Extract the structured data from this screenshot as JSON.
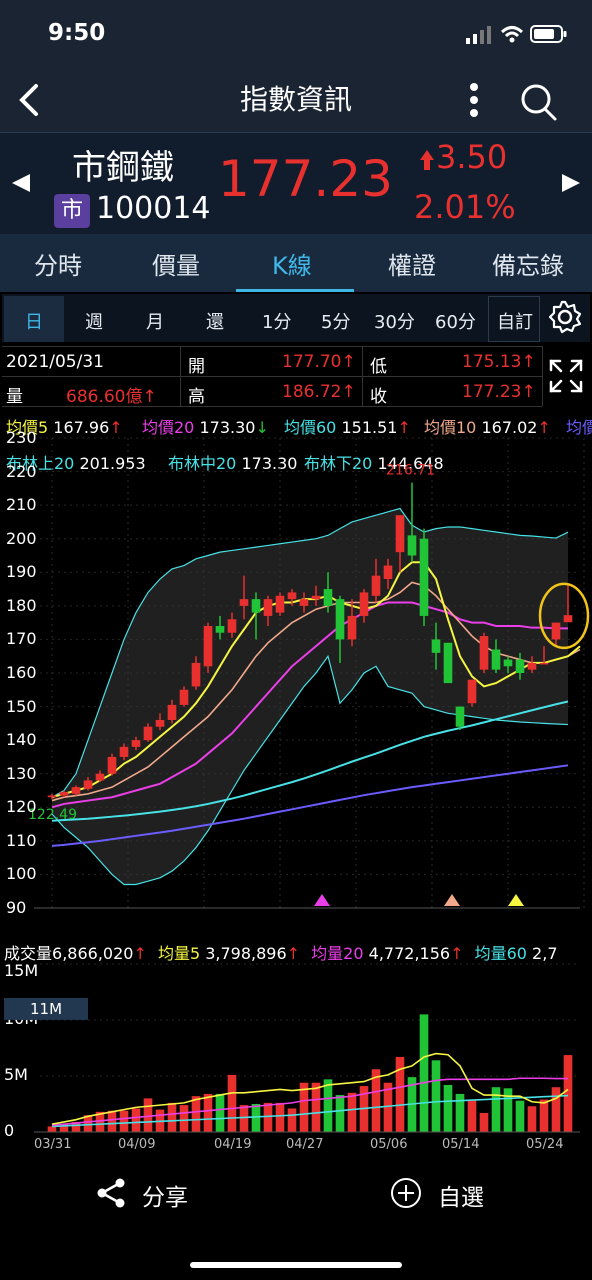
{
  "status": {
    "time": "9:50"
  },
  "nav": {
    "title": "指數資訊"
  },
  "quote": {
    "name": "市鋼鐵",
    "badge": "市",
    "code": "100014",
    "price": "177.23",
    "change": "3.50",
    "percent": "2.01%"
  },
  "tabs": [
    "分時",
    "價量",
    "K線",
    "權證",
    "備忘錄"
  ],
  "periods": [
    "日",
    "週",
    "月",
    "還",
    "1分",
    "5分",
    "30分",
    "60分",
    "自訂"
  ],
  "info": {
    "date": "2021/05/31",
    "open_label": "開",
    "open": "177.70↑",
    "low_label": "低",
    "low": "175.13↑",
    "vol_label": "量",
    "vol": "686.60億↑",
    "high_label": "高",
    "high": "186.72↑",
    "close_label": "收",
    "close": "177.23↑"
  },
  "ma_legend": [
    {
      "label": "均價5",
      "value": "167.96",
      "arrow": "↑",
      "color": "#f5f542"
    },
    {
      "label": "均價20",
      "value": "173.30",
      "arrow": "↓",
      "color": "#ea3fe8"
    },
    {
      "label": "均價60",
      "value": "151.51",
      "arrow": "↑",
      "color": "#47e1e6"
    },
    {
      "label": "均價10",
      "value": "167.02",
      "arrow": "↑",
      "color": "#f2a98b"
    },
    {
      "label": "均價",
      "value": "",
      "arrow": "",
      "color": "#6a5cff"
    }
  ],
  "boll_legend": {
    "upper_label": "布林上20",
    "upper": "201.953",
    "mid_label": "布林中20",
    "mid": "173.30",
    "lower_label": "布林下20",
    "lower": "144.648"
  },
  "price_axis": [
    "230",
    "220",
    "210",
    "200",
    "190",
    "180",
    "170",
    "160",
    "150",
    "140",
    "130",
    "120",
    "110",
    "100",
    "90"
  ],
  "max_label": "216.71",
  "min_label": "122.49",
  "vol_legend": {
    "label": "成交量",
    "value": "6,866,020",
    "ma5_label": "均量5",
    "ma5": "3,798,896",
    "ma20_label": "均量20",
    "ma20": "4,772,156",
    "ma60_label": "均量60",
    "ma60": "2,7"
  },
  "vol_axis": [
    "15M",
    "10M",
    "5M",
    "0"
  ],
  "vol_tag": "11M",
  "dates": [
    "03/31",
    "04/09",
    "04/19",
    "04/27",
    "05/06",
    "05/14",
    "05/24"
  ],
  "bottom": {
    "share": "分享",
    "watch": "自選"
  },
  "colors": {
    "up": "#e8312f",
    "down": "#22c437",
    "accent": "#3fb7e8"
  },
  "icons": [
    "back-arrow-icon",
    "more-vert-icon",
    "search-icon",
    "left-triangle-icon",
    "right-triangle-icon",
    "gear-icon",
    "expand-icon",
    "share-icon",
    "add-circle-icon"
  ],
  "chart_data": {
    "type": "candlestick",
    "ylim": [
      90,
      230
    ],
    "vol_ylim": [
      0,
      15000000
    ],
    "candles": [
      {
        "o": 123,
        "h": 124,
        "l": 122.49,
        "c": 123.5
      },
      {
        "o": 123.5,
        "h": 125,
        "l": 123,
        "c": 124.5
      },
      {
        "o": 124,
        "h": 126.5,
        "l": 123.5,
        "c": 126
      },
      {
        "o": 125.5,
        "h": 129,
        "l": 125,
        "c": 128
      },
      {
        "o": 128,
        "h": 131,
        "l": 127.5,
        "c": 130
      },
      {
        "o": 130,
        "h": 136,
        "l": 129.5,
        "c": 135
      },
      {
        "o": 135,
        "h": 139,
        "l": 134,
        "c": 138
      },
      {
        "o": 138,
        "h": 141,
        "l": 137,
        "c": 140
      },
      {
        "o": 140,
        "h": 145,
        "l": 139.5,
        "c": 144
      },
      {
        "o": 144,
        "h": 148,
        "l": 143,
        "c": 146
      },
      {
        "o": 146,
        "h": 152,
        "l": 145,
        "c": 150.5
      },
      {
        "o": 150.5,
        "h": 156,
        "l": 150,
        "c": 155
      },
      {
        "o": 156,
        "h": 165,
        "l": 155,
        "c": 163
      },
      {
        "o": 162,
        "h": 175,
        "l": 160,
        "c": 174
      },
      {
        "o": 174,
        "h": 177,
        "l": 170,
        "c": 172
      },
      {
        "o": 172,
        "h": 178,
        "l": 170.5,
        "c": 176
      },
      {
        "o": 180,
        "h": 189,
        "l": 176,
        "c": 182
      },
      {
        "o": 182,
        "h": 184,
        "l": 170,
        "c": 178
      },
      {
        "o": 177,
        "h": 183,
        "l": 174,
        "c": 182
      },
      {
        "o": 178,
        "h": 184,
        "l": 177,
        "c": 183
      },
      {
        "o": 182,
        "h": 185,
        "l": 180,
        "c": 184
      },
      {
        "o": 180,
        "h": 184,
        "l": 178,
        "c": 182
      },
      {
        "o": 182,
        "h": 186,
        "l": 180,
        "c": 183
      },
      {
        "o": 185,
        "h": 190,
        "l": 178,
        "c": 180
      },
      {
        "o": 182,
        "h": 183,
        "l": 163,
        "c": 170
      },
      {
        "o": 170,
        "h": 182,
        "l": 168,
        "c": 177
      },
      {
        "o": 177,
        "h": 185,
        "l": 175,
        "c": 184
      },
      {
        "o": 183,
        "h": 194,
        "l": 181,
        "c": 189
      },
      {
        "o": 188,
        "h": 194,
        "l": 185,
        "c": 192
      },
      {
        "o": 196,
        "h": 207,
        "l": 190,
        "c": 207
      },
      {
        "o": 201,
        "h": 216.71,
        "l": 193,
        "c": 195
      },
      {
        "o": 200,
        "h": 203,
        "l": 174,
        "c": 177
      },
      {
        "o": 170,
        "h": 175,
        "l": 161,
        "c": 166
      },
      {
        "o": 169,
        "h": 169,
        "l": 157,
        "c": 157
      },
      {
        "o": 150,
        "h": 150,
        "l": 143,
        "c": 144
      },
      {
        "o": 151,
        "h": 158,
        "l": 150,
        "c": 158
      },
      {
        "o": 161,
        "h": 172,
        "l": 160,
        "c": 171
      },
      {
        "o": 167,
        "h": 170,
        "l": 160,
        "c": 161
      },
      {
        "o": 164,
        "h": 165,
        "l": 160,
        "c": 162
      },
      {
        "o": 164,
        "h": 166,
        "l": 158,
        "c": 160
      },
      {
        "o": 161,
        "h": 165,
        "l": 160,
        "c": 163
      },
      {
        "o": 163,
        "h": 168,
        "l": 163,
        "c": 163
      },
      {
        "o": 170,
        "h": 175,
        "l": 168,
        "c": 175
      },
      {
        "o": 175.13,
        "h": 186.72,
        "l": 175.13,
        "c": 177.23
      }
    ],
    "ma5": [
      123,
      124,
      125,
      126,
      128,
      130,
      133,
      135,
      138,
      141,
      144,
      147,
      151,
      156,
      162,
      168,
      173,
      178,
      180,
      181,
      181,
      182,
      182,
      183,
      181,
      180,
      179,
      180,
      183,
      190,
      193,
      193,
      188,
      176,
      165,
      159,
      156,
      157,
      159,
      161,
      163,
      163,
      164,
      165,
      167.96
    ],
    "ma10": [
      122,
      123,
      123.5,
      124,
      125,
      126,
      128,
      130,
      132,
      135,
      138,
      141,
      144,
      147,
      151,
      155,
      160,
      165,
      169,
      172,
      175,
      177,
      179,
      180,
      181,
      181,
      181,
      181,
      182,
      184,
      187,
      186,
      183,
      179,
      175,
      171,
      168,
      166,
      165,
      164,
      163,
      163,
      164,
      165,
      167.02
    ],
    "ma20": [
      120,
      121,
      121.5,
      122,
      122.5,
      123,
      124,
      125,
      126,
      127,
      129,
      131,
      133,
      136,
      139,
      142,
      146,
      150,
      154,
      158,
      162,
      165,
      168,
      171,
      174,
      176,
      178,
      180,
      181,
      181,
      181,
      180,
      179,
      178,
      176,
      175,
      175,
      174,
      174,
      174,
      173.5,
      173.5,
      173.3,
      173.3
    ],
    "ma60": [
      116,
      116.2,
      116.4,
      116.6,
      116.9,
      117.2,
      117.5,
      117.9,
      118.3,
      118.7,
      119.2,
      119.7,
      120.3,
      121,
      121.8,
      122.6,
      123.5,
      124.5,
      125.5,
      126.5,
      127.5,
      128.6,
      129.8,
      131,
      132.3,
      133.6,
      134.8,
      136,
      137.3,
      138.6,
      139.8,
      141,
      141.9,
      142.8,
      143.6,
      144.4,
      145.3,
      146.2,
      147.1,
      148,
      148.9,
      149.8,
      150.7,
      151.51
    ],
    "ma_long": [
      108.5,
      108.8,
      109.2,
      109.6,
      110,
      110.5,
      111,
      111.5,
      112,
      112.5,
      113,
      113.6,
      114.2,
      114.8,
      115.4,
      116,
      116.6,
      117.3,
      118,
      118.7,
      119.4,
      120.1,
      120.8,
      121.5,
      122.2,
      122.9,
      123.6,
      124.2,
      124.8,
      125.4,
      126,
      126.5,
      127,
      127.5,
      128,
      128.5,
      129,
      129.5,
      130,
      130.5,
      131,
      131.5,
      132,
      132.5
    ],
    "boll_up": [
      123,
      125,
      130,
      140,
      150,
      160,
      170,
      178,
      184,
      188,
      191,
      192,
      194,
      195,
      196,
      196.5,
      197,
      197.5,
      198,
      198.5,
      199,
      199.5,
      200,
      201,
      203,
      205,
      206,
      207,
      208,
      209,
      204,
      202,
      203,
      203.5,
      203.5,
      203,
      202.5,
      202,
      201.5,
      201,
      200.8,
      200.5,
      200.2,
      201.953
    ],
    "boll_low": [
      118,
      114,
      111,
      108,
      104,
      100,
      97,
      97,
      98,
      99,
      101,
      104,
      108,
      113,
      119,
      125,
      131,
      136,
      141,
      146,
      151,
      156,
      160,
      165,
      151,
      155,
      160,
      162,
      156,
      155,
      154,
      150,
      149,
      148,
      147.5,
      147,
      146.5,
      146,
      145.7,
      145.4,
      145.2,
      145,
      144.8,
      144.648
    ],
    "volumes": [
      0.5,
      0.7,
      0.9,
      1.5,
      1.8,
      1.9,
      1.9,
      2.1,
      3.0,
      2.0,
      2.6,
      2.4,
      3.2,
      3.4,
      3.4,
      5.1,
      2.4,
      2.5,
      2.6,
      2.6,
      2.1,
      4.4,
      4.4,
      4.7,
      3.3,
      3.5,
      4.1,
      5.6,
      4.4,
      6.7,
      4.9,
      10.5,
      6.4,
      4.2,
      3.4,
      2.9,
      1.7,
      4.0,
      3.9,
      2.8,
      2.3,
      2.9,
      4.0,
      6.87
    ],
    "vol_ma5": [
      0.7,
      0.9,
      1.1,
      1.4,
      1.6,
      1.8,
      2.0,
      2.2,
      2.3,
      2.4,
      2.5,
      2.6,
      2.9,
      3.1,
      3.3,
      3.5,
      3.5,
      3.6,
      3.7,
      3.8,
      3.7,
      3.8,
      3.9,
      4.2,
      4.3,
      4.4,
      4.5,
      4.9,
      5.1,
      5.6,
      5.9,
      6.7,
      7.0,
      6.9,
      5.9,
      3.9,
      3.3,
      3.3,
      3.2,
      3.2,
      2.7,
      2.6,
      3.0,
      3.8
    ],
    "vol_ma20": [
      0.6,
      0.7,
      0.8,
      0.9,
      1.0,
      1.1,
      1.2,
      1.3,
      1.4,
      1.5,
      1.6,
      1.7,
      1.8,
      1.9,
      2.0,
      2.1,
      2.2,
      2.3,
      2.4,
      2.5,
      2.6,
      2.8,
      2.9,
      3.0,
      3.1,
      3.2,
      3.4,
      3.6,
      3.8,
      4.0,
      4.2,
      4.4,
      4.6,
      4.7,
      4.7,
      4.7,
      4.7,
      4.7,
      4.7,
      4.8,
      4.8,
      4.8,
      4.77,
      4.77
    ],
    "vol_ma60": [
      0.5,
      0.55,
      0.6,
      0.65,
      0.7,
      0.75,
      0.8,
      0.85,
      0.9,
      0.95,
      1.0,
      1.05,
      1.1,
      1.15,
      1.2,
      1.25,
      1.3,
      1.35,
      1.4,
      1.45,
      1.5,
      1.6,
      1.7,
      1.8,
      1.9,
      2.0,
      2.1,
      2.2,
      2.3,
      2.4,
      2.5,
      2.6,
      2.7,
      2.75,
      2.8,
      2.85,
      2.9,
      2.95,
      3.0,
      3.05,
      3.1,
      3.15,
      3.2,
      3.25
    ]
  }
}
